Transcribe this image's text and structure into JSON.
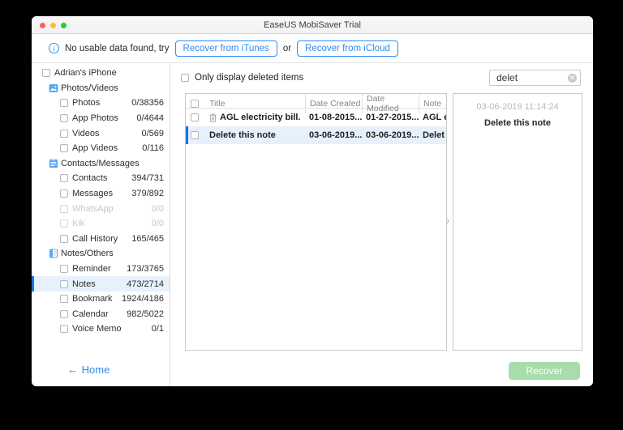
{
  "window": {
    "title": "EaseUS MobiSaver Trial"
  },
  "info_bar": {
    "message": "No usable data found, try",
    "itunes_button": "Recover from iTunes",
    "or_label": "or",
    "icloud_button": "Recover from iCloud"
  },
  "sidebar": {
    "device": {
      "label": "Adrian's iPhone"
    },
    "groups": [
      {
        "label": "Photos/Videos",
        "icon": "photos-icon",
        "items": [
          {
            "label": "Photos",
            "count": "0/38356"
          },
          {
            "label": "App Photos",
            "count": "0/4644"
          },
          {
            "label": "Videos",
            "count": "0/569"
          },
          {
            "label": "App Videos",
            "count": "0/116"
          }
        ]
      },
      {
        "label": "Contacts/Messages",
        "icon": "contacts-icon",
        "items": [
          {
            "label": "Contacts",
            "count": "394/731"
          },
          {
            "label": "Messages",
            "count": "379/892"
          },
          {
            "label": "WhatsApp",
            "count": "0/0",
            "disabled": true
          },
          {
            "label": "Kik",
            "count": "0/0",
            "disabled": true
          },
          {
            "label": "Call History",
            "count": "165/465"
          }
        ]
      },
      {
        "label": "Notes/Others",
        "icon": "notes-icon",
        "items": [
          {
            "label": "Reminder",
            "count": "173/3765"
          },
          {
            "label": "Notes",
            "count": "473/2714",
            "selected": true
          },
          {
            "label": "Bookmark",
            "count": "1924/4186"
          },
          {
            "label": "Calendar",
            "count": "982/5022"
          },
          {
            "label": "Voice Memo",
            "count": "0/1"
          }
        ]
      }
    ],
    "home_label": "Home"
  },
  "toolbar": {
    "filter_checkbox_label": "Only display deleted items",
    "search_value": "delet"
  },
  "table": {
    "columns": [
      "Title",
      "Date Created",
      "Date Modified",
      "Note"
    ],
    "rows": [
      {
        "title": "AGL electricity bill.",
        "date_created": "01-08-2015...",
        "date_modified": "01-27-2015...",
        "note": "AGL e",
        "deleted": true,
        "selected": false
      },
      {
        "title": "Delete this note",
        "date_created": "03-06-2019...",
        "date_modified": "03-06-2019...",
        "note": "Delet",
        "deleted": false,
        "selected": true
      }
    ]
  },
  "preview": {
    "timestamp": "03-06-2019 11:14:24",
    "title": "Delete this note"
  },
  "footer": {
    "recover_label": "Recover"
  },
  "colors": {
    "accent_blue": "#2e8cf0",
    "selection_bar": "#1673e6",
    "selection_bg": "#e7f1fc",
    "recover_green": "#a9dcab",
    "traffic_red": "#ff5f57",
    "traffic_yellow": "#febc2e",
    "traffic_green": "#28c840"
  }
}
